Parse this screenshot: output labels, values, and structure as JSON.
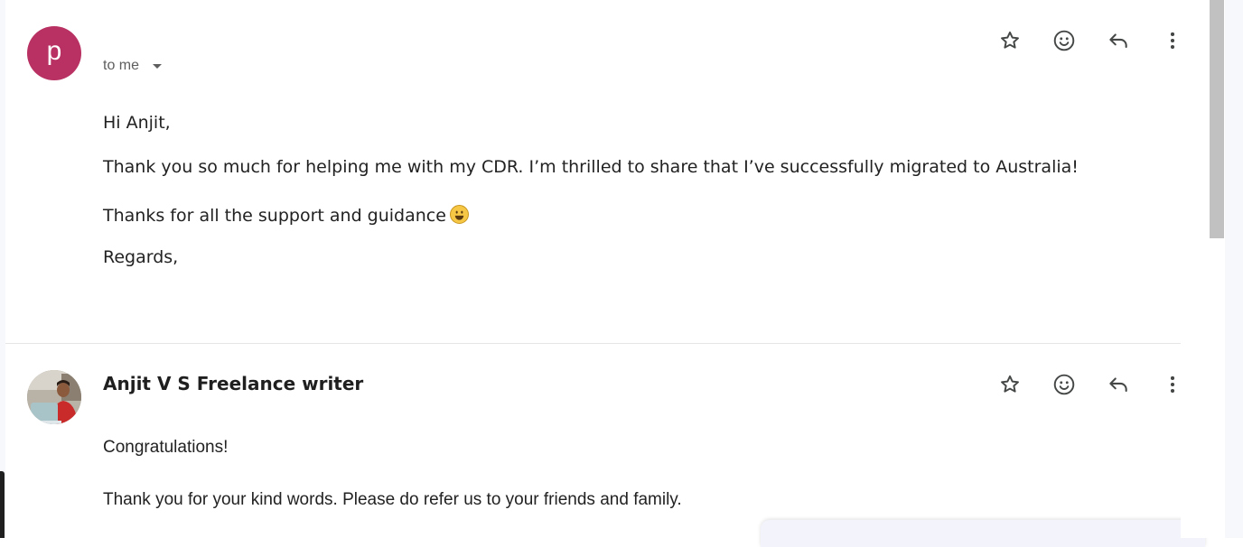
{
  "message1": {
    "avatar_letter": "p",
    "sender": "",
    "recipient": "to me",
    "greeting": "Hi Anjit,",
    "paragraph1": "Thank you so much for helping me with my CDR. I’m thrilled to share that I’ve successfully migrated to Australia!",
    "paragraph2": "Thanks for all the support and guidance",
    "closing": "Regards,",
    "colors": {
      "avatar": "#b83162"
    }
  },
  "message2": {
    "sender": "Anjit V S Freelance writer",
    "line1": "Congratulations!",
    "line2": "Thank you for your kind words. Please do refer us to your friends and family."
  },
  "actions": {
    "icons": [
      "star-icon",
      "emoji-react-icon",
      "reply-icon",
      "more-vert-icon"
    ]
  }
}
